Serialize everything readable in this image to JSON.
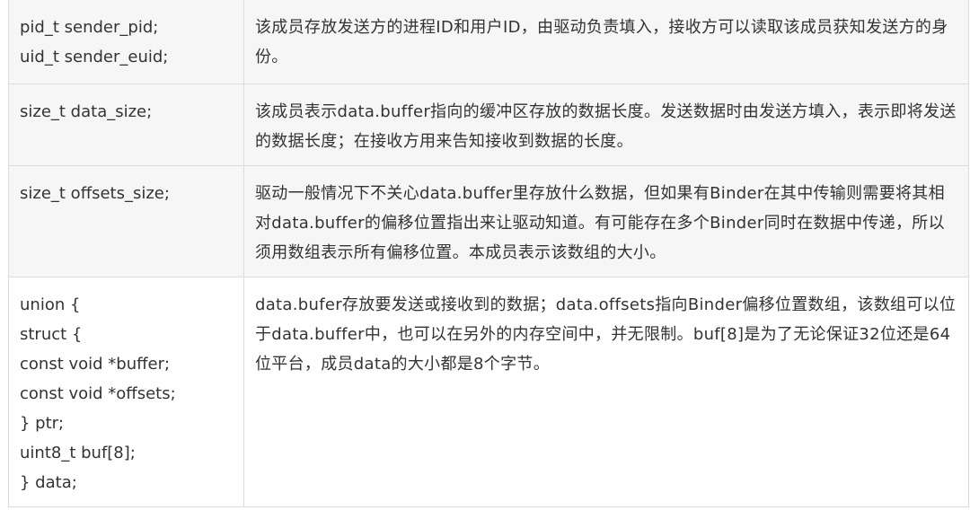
{
  "table": {
    "rows": [
      {
        "field_lines": [
          "pid_t sender_pid;",
          "uid_t sender_euid;"
        ],
        "description": "该成员存放发送方的进程ID和用户ID，由驱动负责填入，接收方可以读取该成员获知发送方的身份。"
      },
      {
        "field_lines": [
          "size_t data_size;"
        ],
        "description": "该成员表示data.buffer指向的缓冲区存放的数据长度。发送数据时由发送方填入，表示即将发送的数据长度；在接收方用来告知接收到数据的长度。"
      },
      {
        "field_lines": [
          "size_t offsets_size;"
        ],
        "description": "驱动一般情况下不关心data.buffer里存放什么数据，但如果有Binder在其中传输则需要将其相对data.buffer的偏移位置指出来让驱动知道。有可能存在多个Binder同时在数据中传递，所以须用数组表示所有偏移位置。本成员表示该数组的大小。"
      },
      {
        "field_lines": [
          "union {",
          "struct {",
          "const void *buffer;",
          "const void *offsets;",
          "} ptr;",
          "uint8_t buf[8];",
          "} data;"
        ],
        "description": "data.bufer存放要发送或接收到的数据；data.offsets指向Binder偏移位置数组，该数组可以位于data.buffer中，也可以在另外的内存空间中，并无限制。buf[8]是为了无论保证32位还是64位平台，成员data的大小都是8个字节。"
      }
    ]
  },
  "colors": {
    "shaded_row": "#f6f6f6",
    "border": "#dcdcdc",
    "text": "#333333"
  }
}
